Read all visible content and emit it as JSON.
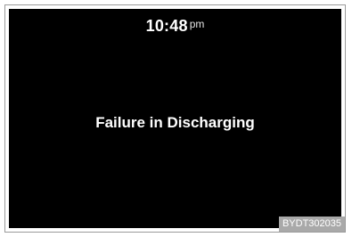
{
  "clock": {
    "time": "10:48",
    "period": "pm"
  },
  "message": {
    "text": "Failure in Discharging"
  },
  "reference": {
    "code": "BYDT302035"
  },
  "colors": {
    "screen_background": "#000000",
    "text": "#ffffff",
    "reference_badge": "#a9a9a9"
  }
}
